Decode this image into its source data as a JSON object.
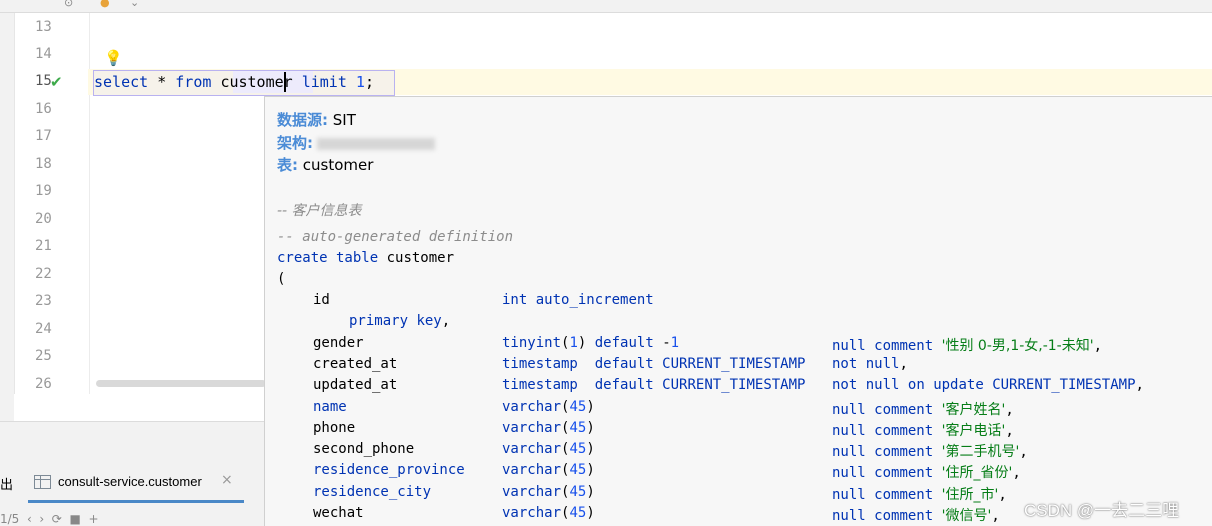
{
  "editor": {
    "line_numbers": [
      "13",
      "14",
      "15",
      "16",
      "17",
      "18",
      "19",
      "20",
      "21",
      "22",
      "23",
      "24",
      "25",
      "26"
    ],
    "query": {
      "select": "select",
      "star": " * ",
      "from": "from",
      "table": "customer",
      "limit": "limit",
      "num": "1",
      "end": ";"
    }
  },
  "popup": {
    "datasource_label": "数据源:",
    "datasource_value": "SIT",
    "schema_label": "架构:",
    "table_label": "表:",
    "table_value": "customer",
    "table_comment": "-- 客户信息表",
    "ddl": {
      "autogen": "-- auto-generated definition",
      "create_kw": "create table",
      "create_name": " customer",
      "open_paren": "(",
      "lines": [
        {
          "col": "id",
          "type": "int auto_increment",
          "rest": ""
        },
        {
          "col": "",
          "type": "",
          "rest": "primary key,"
        },
        {
          "col": "gender",
          "type": "tinyint(1) default -1",
          "rest": "null comment '性别 0-男,1-女,-1-未知',"
        },
        {
          "col": "created_at",
          "type": "timestamp  default CURRENT_TIMESTAMP",
          "rest": "not null,"
        },
        {
          "col": "updated_at",
          "type": "timestamp  default CURRENT_TIMESTAMP",
          "rest": "not null on update CURRENT_TIMESTAMP,"
        },
        {
          "col": "name",
          "type": "varchar(45)",
          "rest": "null comment '客户姓名',"
        },
        {
          "col": "phone",
          "type": "varchar(45)",
          "rest": "null comment '客户电话',"
        },
        {
          "col": "second_phone",
          "type": "varchar(45)",
          "rest": "null comment '第二手机号',"
        },
        {
          "col": "residence_province",
          "type": "varchar(45)",
          "rest": "null comment '住所_省份',"
        },
        {
          "col": "residence_city",
          "type": "varchar(45)",
          "rest": "null comment '住所_市',"
        },
        {
          "col": "wechat",
          "type": "varchar(45)",
          "rest": "null comment '微信号',"
        }
      ]
    }
  },
  "bottom": {
    "tab_left_fragment": "出",
    "tab_label": "consult-service.customer",
    "tab_close": "×",
    "tools": "1/5  ‹  ›  ⟳  ■  +"
  },
  "watermark": "CSDN @一去二三哩",
  "colors": {
    "keyword": "#0033b3",
    "string": "#067d17",
    "number": "#1750eb",
    "comment": "#8c8c8c",
    "meta_label": "#4a8bd6"
  }
}
